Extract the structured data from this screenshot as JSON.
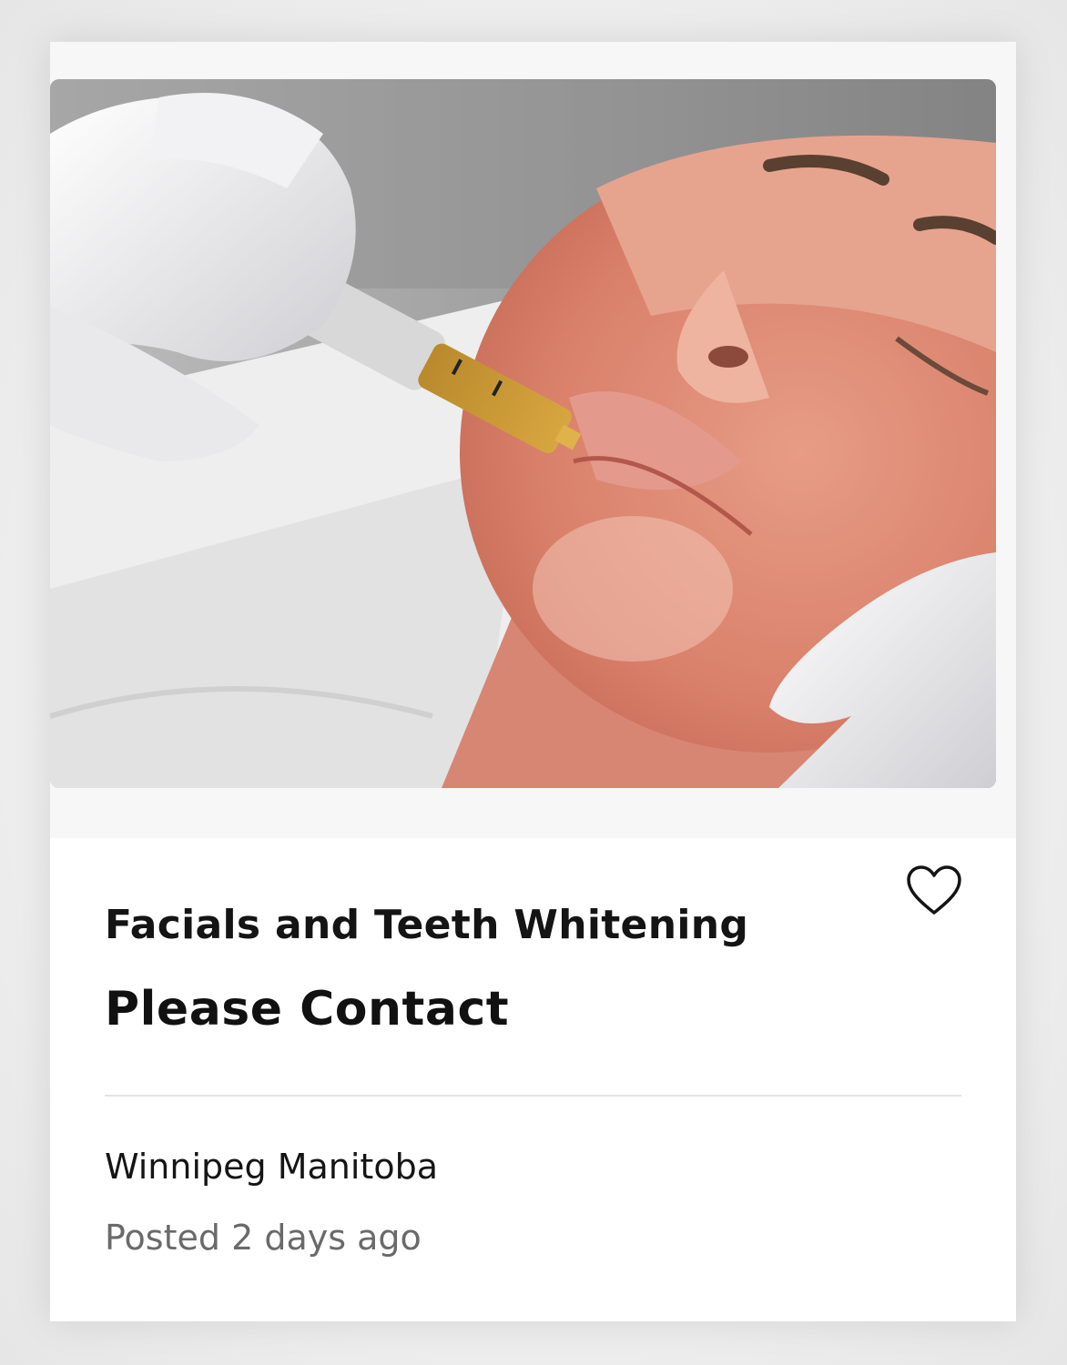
{
  "listing": {
    "title": "Facials and Teeth Whitening",
    "price": "Please Contact",
    "location": "Winnipeg Manitoba",
    "posted": "Posted 2 days ago",
    "favorite_icon": "heart-outline-icon",
    "image": {
      "syringe_marks": [
        "0.5",
        "1.0"
      ]
    }
  },
  "colors": {
    "text_primary": "#141414",
    "text_secondary": "#6a6a6a",
    "divider": "#e3e3e3",
    "card_bg": "#ffffff"
  }
}
